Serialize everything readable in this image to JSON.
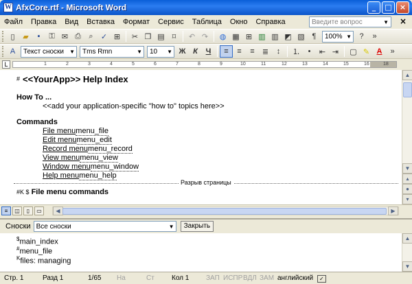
{
  "window": {
    "title": "AfxCore.rtf - Microsoft Word"
  },
  "menu": {
    "items": [
      "Файл",
      "Правка",
      "Вид",
      "Вставка",
      "Формат",
      "Сервис",
      "Таблица",
      "Окно",
      "Справка"
    ],
    "help_search_placeholder": "Введите вопрос"
  },
  "toolbar1": {
    "zoom": "100%"
  },
  "toolbar2": {
    "style": "Текст сноски",
    "font": "Tms Rmn",
    "size": "10",
    "bold": "Ж",
    "italic": "К",
    "underline": "Ч"
  },
  "ruler": {
    "marks": [
      "1",
      "2",
      "3",
      "4",
      "5",
      "6",
      "7",
      "8",
      "9",
      "10",
      "11",
      "12",
      "13",
      "14",
      "15",
      "16",
      "18"
    ]
  },
  "document": {
    "heading_mark": "#",
    "heading": "<<YourApp>> Help Index",
    "howto_title": "How To ...",
    "howto_text": "<<add your application-specific \"how to\" topics here>>",
    "commands_title": "Commands",
    "commands": [
      {
        "link": "File menu",
        "id": "menu_file"
      },
      {
        "link": "Edit menu",
        "id": "menu_edit"
      },
      {
        "link": "Record menu",
        "id": "menu_record"
      },
      {
        "link": "View menu",
        "id": "menu_view"
      },
      {
        "link": "Window menu",
        "id": "menu_window"
      },
      {
        "link": "Help menu",
        "id": "menu_help"
      }
    ],
    "page_break": "Разрыв страницы",
    "next_marks": "#K $",
    "next_heading": "File menu commands"
  },
  "footnotes": {
    "label": "Сноски",
    "select": "Все сноски",
    "close": "Закрыть",
    "entries": [
      {
        "mark": "$",
        "text": "main_index"
      },
      {
        "mark": "#",
        "text": "menu_file"
      },
      {
        "mark": "K",
        "text": "files: managing"
      }
    ]
  },
  "status": {
    "page": "Стр. 1",
    "section": "Разд 1",
    "pages": "1/65",
    "at": "На",
    "line": "Ст",
    "col": "Кол 1",
    "rec": "ЗАП",
    "trk": "ИСПР",
    "ext": "ВДЛ",
    "ovr": "ЗАМ",
    "lang": "английский"
  }
}
